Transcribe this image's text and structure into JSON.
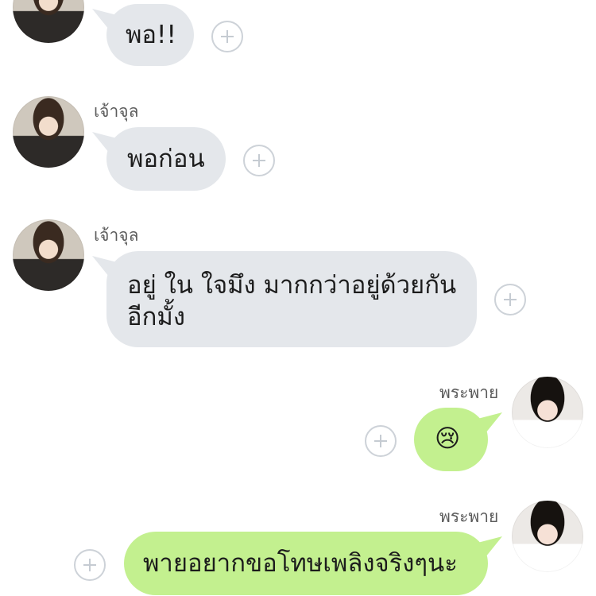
{
  "messages": [
    {
      "sender": "",
      "text": "พอ!!"
    },
    {
      "sender": "เจ้าจุล",
      "text": "พอก่อน"
    },
    {
      "sender": "เจ้าจุล",
      "line1": "อยู่ ใน ใจมึง มากกว่าอยู่ด้วยกัน",
      "line2": "อีกมั้ง"
    },
    {
      "sender": "พระพาย",
      "text": "😢"
    },
    {
      "sender": "พระพาย",
      "text": "พายอยากขอโทษเพลิงจริงๆนะ"
    }
  ],
  "colors": {
    "incoming_bubble": "#e4e7eb",
    "outgoing_bubble": "#c3f08f"
  },
  "icons": {
    "add": "plus-circle-icon"
  }
}
